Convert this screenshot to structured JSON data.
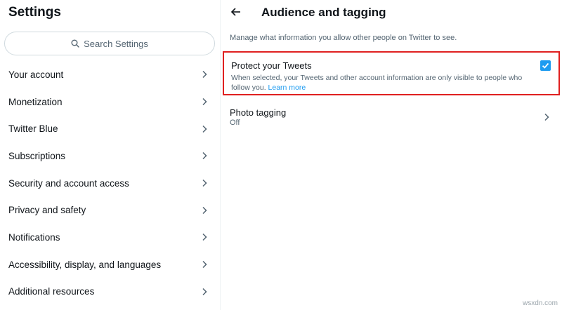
{
  "sidebar": {
    "title": "Settings",
    "search_placeholder": "Search Settings",
    "items": [
      {
        "label": "Your account"
      },
      {
        "label": "Monetization"
      },
      {
        "label": "Twitter Blue"
      },
      {
        "label": "Subscriptions"
      },
      {
        "label": "Security and account access"
      },
      {
        "label": "Privacy and safety"
      },
      {
        "label": "Notifications"
      },
      {
        "label": "Accessibility, display, and languages"
      },
      {
        "label": "Additional resources"
      }
    ]
  },
  "panel": {
    "title": "Audience and tagging",
    "description": "Manage what information you allow other people on Twitter to see.",
    "protect": {
      "title": "Protect your Tweets",
      "description": "When selected, your Tweets and other account information are only visible to people who follow you.",
      "learn_more": "Learn more",
      "checked": true
    },
    "photo_tagging": {
      "title": "Photo tagging",
      "value": "Off"
    }
  },
  "watermark": "wsxdn.com",
  "colors": {
    "accent": "#1d9bf0",
    "highlight_border": "#e02020",
    "secondary_text": "#536471"
  }
}
